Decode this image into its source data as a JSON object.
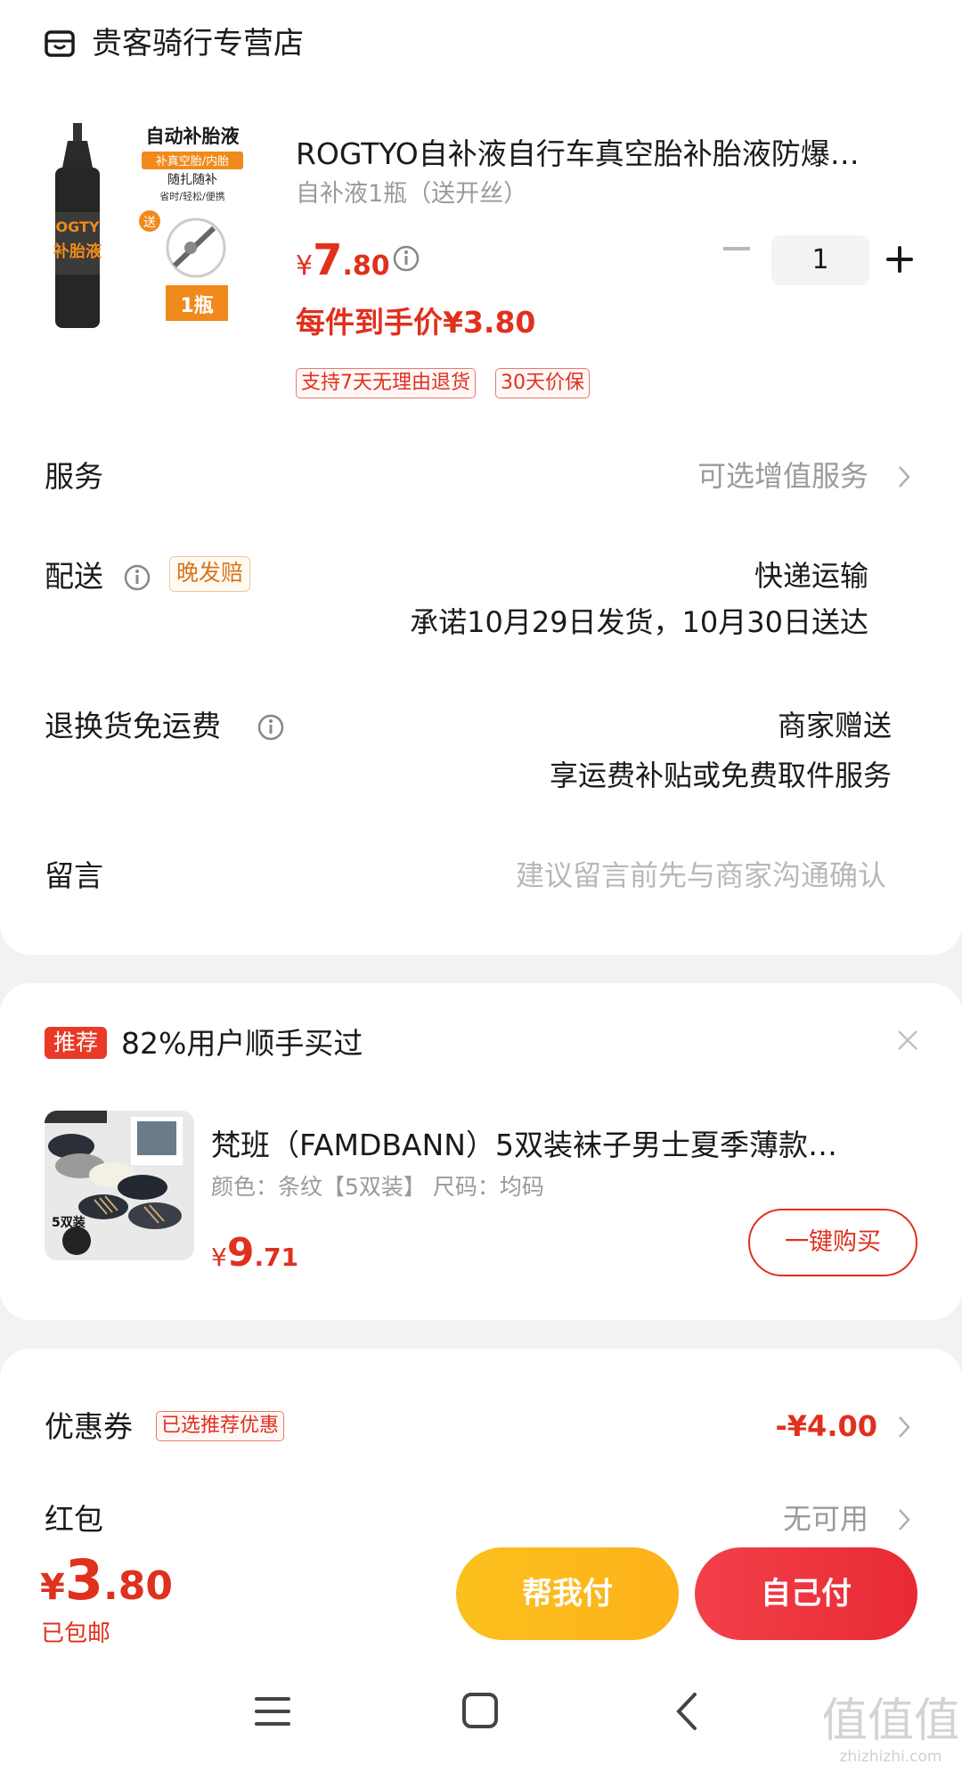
{
  "store": {
    "name": "贵客骑行专营店"
  },
  "product": {
    "title": "ROGTYO自补液自行车真空胎补胎液防爆…",
    "variant": "自补液1瓶（送开丝）",
    "price_currency": "¥",
    "price_int": "7",
    "price_dec": ".80",
    "quantity": "1",
    "final_price": "每件到手价¥3.80",
    "tags": [
      "支持7天无理由退货",
      "30天价保"
    ],
    "image": {
      "heading": "自动补胎液",
      "subheading": "补真空胎/内胎",
      "line1": "随扎随补",
      "line2": "省时/轻松/便携",
      "gift": "送",
      "count": "1瓶",
      "bottle_text": "OGTY",
      "bottle_label": "补胎液"
    }
  },
  "rows": {
    "service": {
      "label": "服务",
      "value": "可选增值服务"
    },
    "delivery": {
      "label": "配送",
      "badge": "晚发赔",
      "method": "快递运输",
      "promise": "承诺10月29日发货，10月30日送达"
    },
    "return": {
      "label": "退换货免运费",
      "value1": "商家赠送",
      "value2": "享运费补贴或免费取件服务"
    },
    "message": {
      "label": "留言",
      "placeholder": "建议留言前先与商家沟通确认"
    }
  },
  "recommend": {
    "badge": "推荐",
    "title": "82%用户顺手买过",
    "item_name": "梵班（FAMDBANN）5双装袜子男士夏季薄款…",
    "item_spec": "颜色：条纹【5双装】   尺码：均码",
    "price_currency": "¥",
    "price_int": "9",
    "price_dec": ".71",
    "buy_label": "一键购买",
    "image_label": "5双装"
  },
  "coupon": {
    "label": "优惠券",
    "tag": "已选推荐优惠",
    "value": "-¥4.00"
  },
  "redpacket": {
    "label": "红包",
    "value": "无可用"
  },
  "footer": {
    "currency": "¥",
    "total_int": "3",
    "total_dec": ".80",
    "shipping": "已包邮",
    "help_pay": "帮我付",
    "self_pay": "自己付"
  },
  "watermark": {
    "text": "值",
    "site": "zhizhizhi.com"
  },
  "colors": {
    "accent": "#e0301e",
    "help_button": "#fdb81a",
    "pay_button": "#ec323c"
  }
}
